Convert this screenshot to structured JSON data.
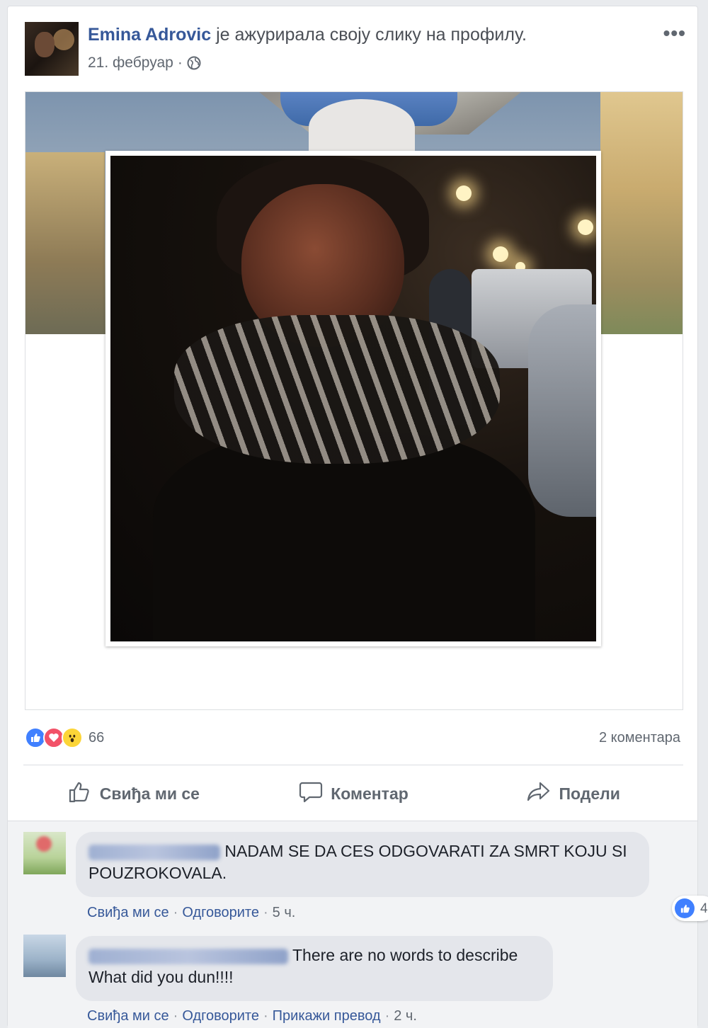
{
  "post": {
    "author": "Emina Adrovic",
    "action_text": "је ажурирала своју слику на профилу.",
    "date": "21. фебруар",
    "date_sep": "·",
    "more_label": "•••"
  },
  "reactions": {
    "count": "66",
    "comments_count": "2 коментара",
    "types": [
      "like-icon",
      "love-icon",
      "wow-icon"
    ],
    "colors": {
      "like": "#4080ff",
      "love": "#f25268",
      "wow": "#fcd538"
    }
  },
  "actions": {
    "like": "Свиђа ми се",
    "comment": "Коментар",
    "share": "Подели"
  },
  "comments": [
    {
      "text": "NADAM SE DA CES ODGOVARATI ZA SMRT KOJU SI POUZROKOVALA.",
      "links": [
        "Свиђа ми се",
        "Одговорите"
      ],
      "time": "5 ч.",
      "likes": "4"
    },
    {
      "text_line1": "There are no words to describe",
      "text_line2": "What did you dun!!!!",
      "links": [
        "Свиђа ми се",
        "Одговорите",
        "Прикажи превод"
      ],
      "time": "2 ч."
    }
  ],
  "theme": {
    "link": "#365899",
    "background": "#e9ebee",
    "card": "#ffffff"
  }
}
